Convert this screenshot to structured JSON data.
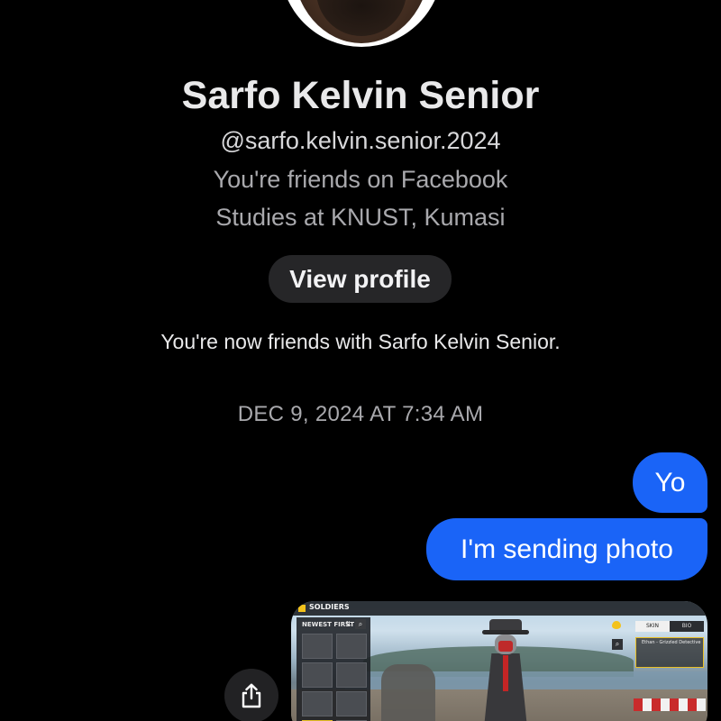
{
  "contact": {
    "name": "Sarfo Kelvin Senior",
    "handle": "@sarfo.kelvin.senior.2024",
    "friendship": "You're friends on Facebook",
    "education": "Studies at KNUST, Kumasi",
    "view_profile_label": "View profile"
  },
  "conversation": {
    "system_message": "You're now friends with Sarfo Kelvin Senior.",
    "timestamp": "DEC 9, 2024 AT 7:34 AM",
    "messages": [
      {
        "sender": "me",
        "text": "Yo"
      },
      {
        "sender": "me",
        "text": "I'm sending photo"
      }
    ],
    "photo": {
      "header": "SOLDIERS",
      "sort_label": "NEWEST FIRST",
      "tabs": [
        "SKIN",
        "BIO"
      ],
      "detail_text": "Ethan - Grizzled Detective"
    }
  },
  "colors": {
    "background": "#000000",
    "outgoing_bubble": "#1a64f7",
    "button_bg": "#262628"
  },
  "icons": {
    "share": "share-icon"
  }
}
